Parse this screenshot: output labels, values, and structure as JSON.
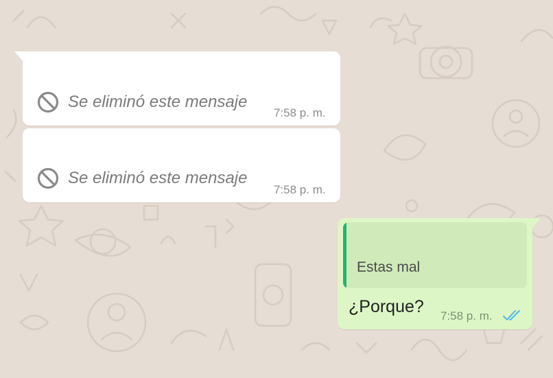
{
  "chat": {
    "deleted_messages": [
      {
        "text": "Se eliminó este mensaje",
        "time": "7:58 p. m.",
        "icon": "ban-icon"
      },
      {
        "text": "Se eliminó este mensaje",
        "time": "7:58 p. m.",
        "icon": "ban-icon"
      }
    ],
    "sent_message": {
      "quoted_text": "Estas mal",
      "text": "¿Porque?",
      "time": "7:58 p. m.",
      "status_icon": "double-check-read-icon"
    }
  },
  "colors": {
    "wallpaper": "#e6ddd4",
    "incoming_bubble": "#ffffff",
    "outgoing_bubble": "#dcf7c5",
    "quote_background": "#d0ebb9",
    "quote_bar": "#25b371",
    "read_ticks": "#4fb6ec"
  }
}
